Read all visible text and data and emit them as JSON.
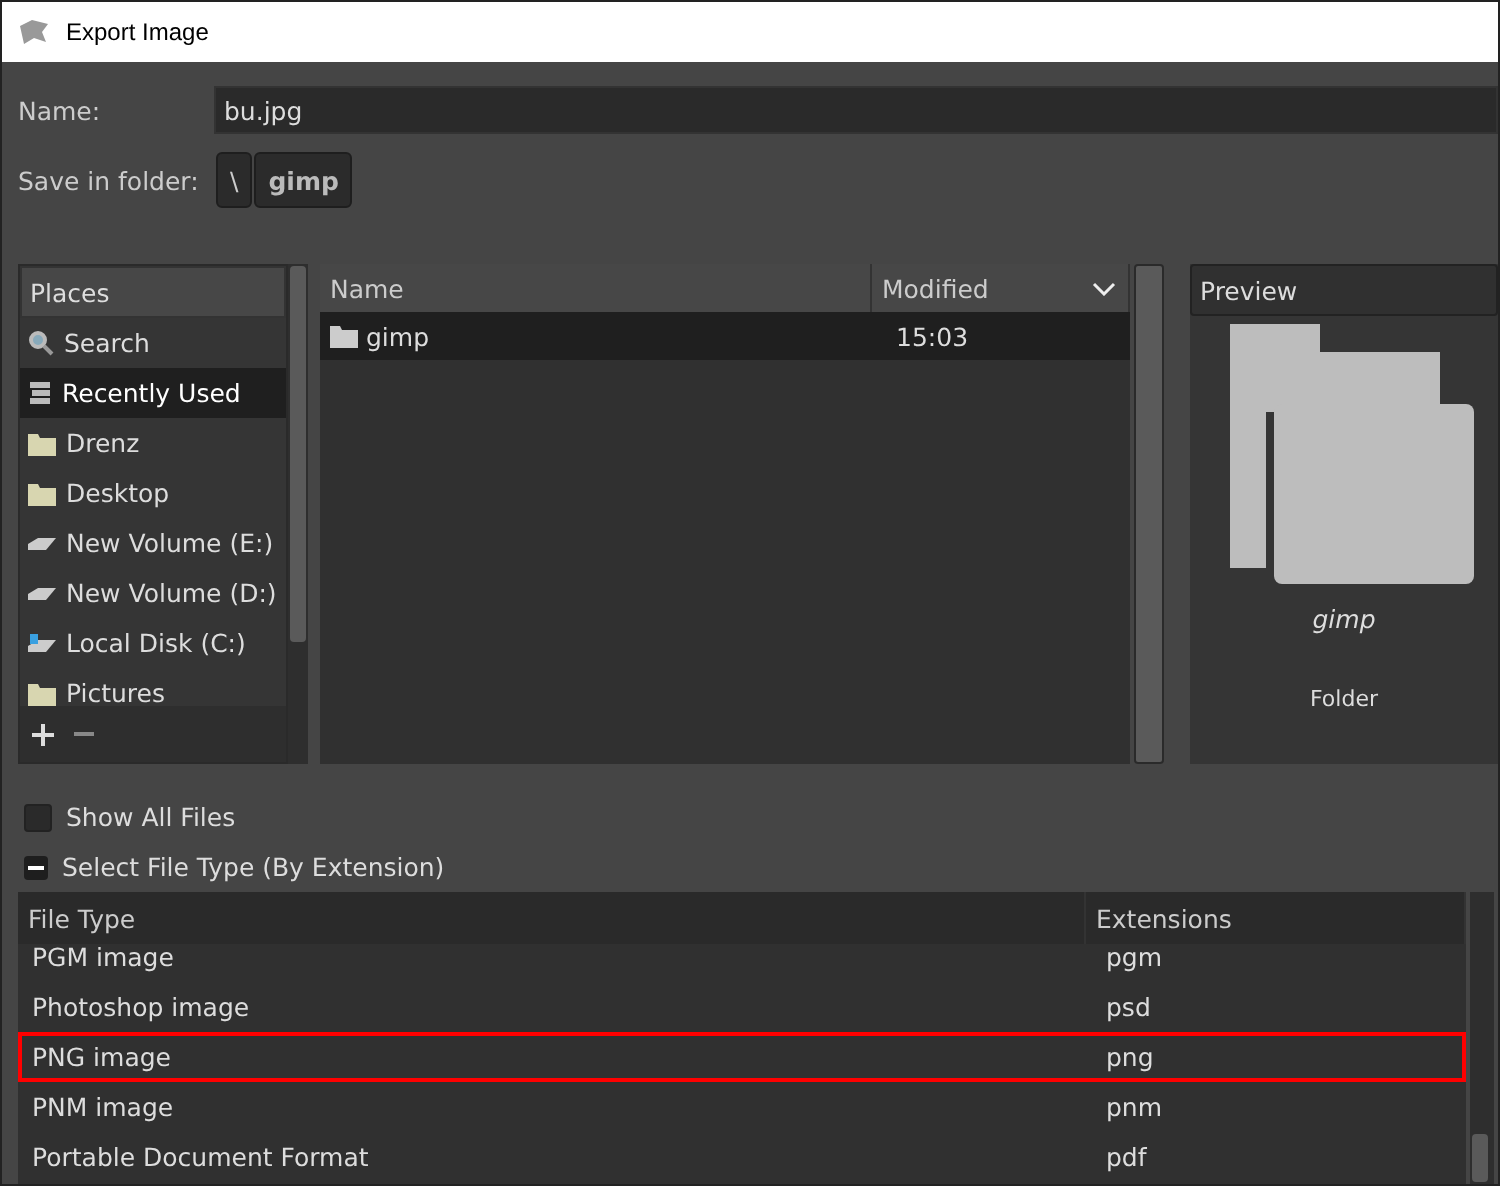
{
  "window": {
    "title": "Export Image"
  },
  "name_field": {
    "label": "Name:",
    "value": "bu.jpg"
  },
  "save_in_folder": {
    "label": "Save in folder:",
    "path": [
      {
        "label": "\\",
        "selected": false
      },
      {
        "label": "gimp",
        "selected": true
      }
    ]
  },
  "places": {
    "heading": "Places",
    "items": [
      {
        "label": "Search",
        "kind": "search",
        "selected": false
      },
      {
        "label": "Recently Used",
        "kind": "recent",
        "selected": true
      },
      {
        "label": "Drenz",
        "kind": "folder",
        "selected": false
      },
      {
        "label": "Desktop",
        "kind": "folder",
        "selected": false
      },
      {
        "label": "New Volume (E:)",
        "kind": "drive",
        "selected": false
      },
      {
        "label": "New Volume (D:)",
        "kind": "drive",
        "selected": false
      },
      {
        "label": "Local Disk (C:)",
        "kind": "system",
        "selected": false
      },
      {
        "label": "Pictures",
        "kind": "folder",
        "selected": false
      }
    ]
  },
  "files": {
    "columns": [
      "Name",
      "Modified"
    ],
    "rows": [
      {
        "name": "gimp",
        "modified": "15:03",
        "selected": true
      }
    ]
  },
  "preview": {
    "heading": "Preview",
    "name": "gimp",
    "type": "Folder"
  },
  "show_all_files": {
    "label": "Show All Files",
    "checked": false
  },
  "select_file_type": {
    "label": "Select File Type (By Extension)",
    "expanded": true
  },
  "file_types": {
    "columns": [
      "File Type",
      "Extensions"
    ],
    "rows": [
      {
        "type": "PGM image",
        "ext": "pgm",
        "highlighted": false
      },
      {
        "type": "Photoshop image",
        "ext": "psd",
        "highlighted": false
      },
      {
        "type": "PNG image",
        "ext": "png",
        "highlighted": true
      },
      {
        "type": "PNM image",
        "ext": "pnm",
        "highlighted": false
      },
      {
        "type": "Portable Document Format",
        "ext": "pdf",
        "highlighted": false
      }
    ]
  }
}
